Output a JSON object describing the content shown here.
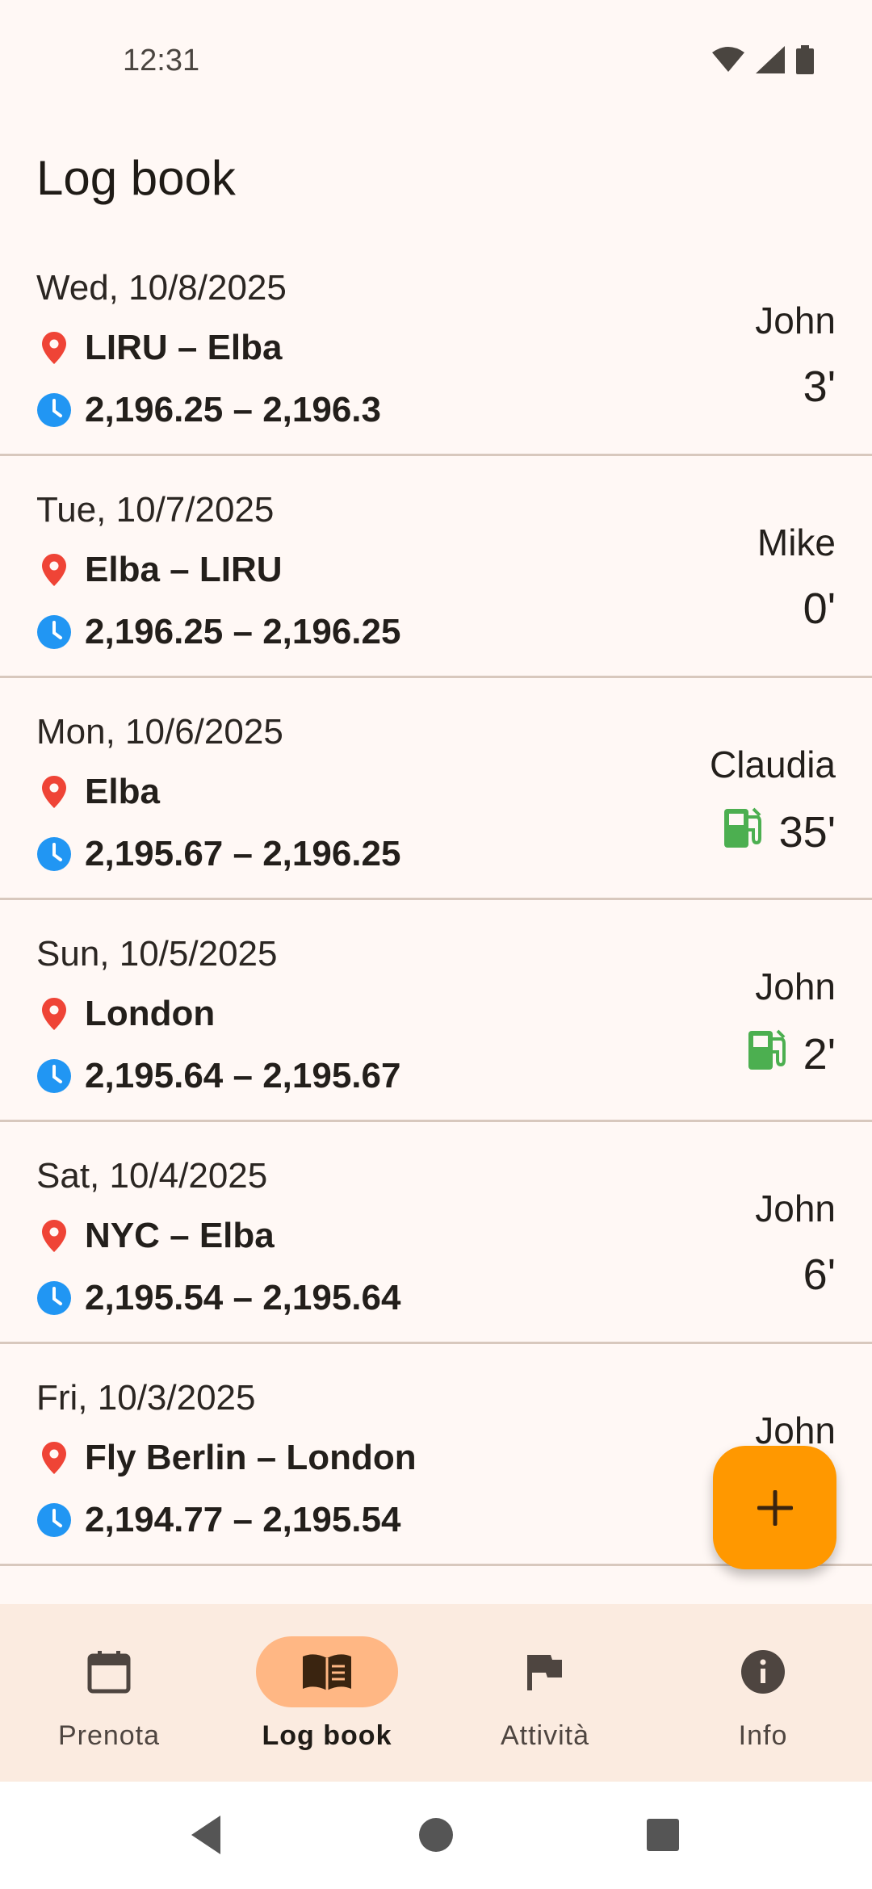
{
  "status_bar": {
    "time": "12:31"
  },
  "header": {
    "title": "Log book"
  },
  "entries": [
    {
      "date": "Wed, 10/8/2025",
      "route": "LIRU – Elba",
      "hours": "2,196.25 – 2,196.3",
      "pilot": "John",
      "duration": "3'",
      "fuel": false
    },
    {
      "date": "Tue, 10/7/2025",
      "route": "Elba – LIRU",
      "hours": "2,196.25 – 2,196.25",
      "pilot": "Mike",
      "duration": "0'",
      "fuel": false
    },
    {
      "date": "Mon, 10/6/2025",
      "route": "Elba",
      "hours": "2,195.67 – 2,196.25",
      "pilot": "Claudia",
      "duration": "35'",
      "fuel": true
    },
    {
      "date": "Sun, 10/5/2025",
      "route": "London",
      "hours": "2,195.64 – 2,195.67",
      "pilot": "John",
      "duration": "2'",
      "fuel": true
    },
    {
      "date": "Sat, 10/4/2025",
      "route": "NYC – Elba",
      "hours": "2,195.54 – 2,195.64",
      "pilot": "John",
      "duration": "6'",
      "fuel": false
    },
    {
      "date": "Fri, 10/3/2025",
      "route": "Fly Berlin – London",
      "hours": "2,194.77 – 2,195.54",
      "pilot": "John",
      "duration": "",
      "fuel": false
    }
  ],
  "fab": {
    "icon": "plus-icon"
  },
  "bottom_nav": {
    "items": [
      {
        "label": "Prenota",
        "icon": "calendar-icon",
        "active": false
      },
      {
        "label": "Log book",
        "icon": "book-icon",
        "active": true
      },
      {
        "label": "Attività",
        "icon": "flag-icon",
        "active": false
      },
      {
        "label": "Info",
        "icon": "info-icon",
        "active": false
      }
    ]
  },
  "colors": {
    "accent": "#ff9800",
    "nav_active": "#ffb784",
    "location_icon": "#ef4436",
    "clock_icon": "#2196f3",
    "fuel_icon": "#4caf50"
  }
}
